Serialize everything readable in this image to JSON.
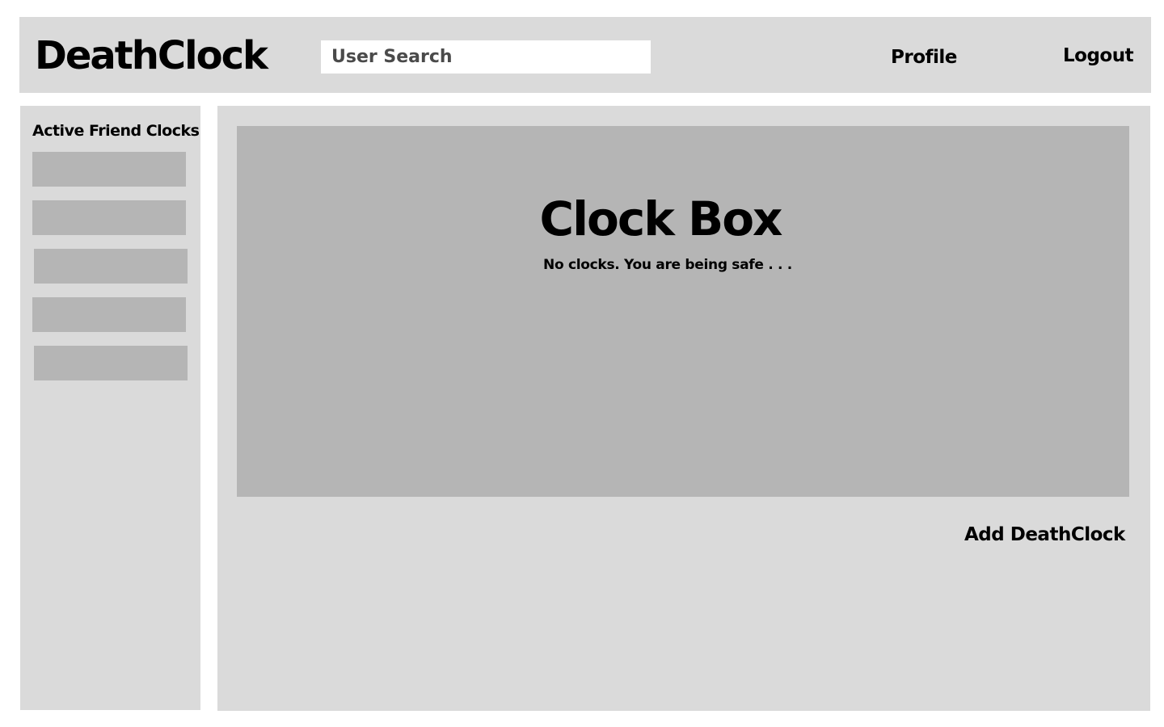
{
  "header": {
    "logo": "DeathClock",
    "search_placeholder": "User Search",
    "nav": {
      "profile": "Profile",
      "logout": "Logout"
    }
  },
  "sidebar": {
    "title": "Active Friend Clocks",
    "friend_clock_count": 5
  },
  "main": {
    "clock_box": {
      "title": "Clock Box",
      "message": "No clocks. You are being safe . . ."
    },
    "add_button": "Add DeathClock"
  },
  "colors": {
    "panel_bg": "#dadada",
    "placeholder_block": "#b5b5b5",
    "page_bg": "#ffffff"
  }
}
